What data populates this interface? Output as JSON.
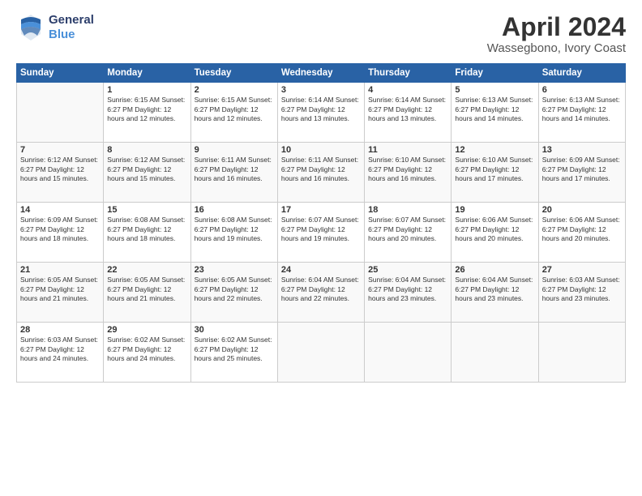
{
  "header": {
    "logo_line1": "General",
    "logo_line2": "Blue",
    "title": "April 2024",
    "subtitle": "Wassegbono, Ivory Coast"
  },
  "weekdays": [
    "Sunday",
    "Monday",
    "Tuesday",
    "Wednesday",
    "Thursday",
    "Friday",
    "Saturday"
  ],
  "weeks": [
    [
      {
        "day": "",
        "info": ""
      },
      {
        "day": "1",
        "info": "Sunrise: 6:15 AM\nSunset: 6:27 PM\nDaylight: 12 hours\nand 12 minutes."
      },
      {
        "day": "2",
        "info": "Sunrise: 6:15 AM\nSunset: 6:27 PM\nDaylight: 12 hours\nand 12 minutes."
      },
      {
        "day": "3",
        "info": "Sunrise: 6:14 AM\nSunset: 6:27 PM\nDaylight: 12 hours\nand 13 minutes."
      },
      {
        "day": "4",
        "info": "Sunrise: 6:14 AM\nSunset: 6:27 PM\nDaylight: 12 hours\nand 13 minutes."
      },
      {
        "day": "5",
        "info": "Sunrise: 6:13 AM\nSunset: 6:27 PM\nDaylight: 12 hours\nand 14 minutes."
      },
      {
        "day": "6",
        "info": "Sunrise: 6:13 AM\nSunset: 6:27 PM\nDaylight: 12 hours\nand 14 minutes."
      }
    ],
    [
      {
        "day": "7",
        "info": "Sunrise: 6:12 AM\nSunset: 6:27 PM\nDaylight: 12 hours\nand 15 minutes."
      },
      {
        "day": "8",
        "info": "Sunrise: 6:12 AM\nSunset: 6:27 PM\nDaylight: 12 hours\nand 15 minutes."
      },
      {
        "day": "9",
        "info": "Sunrise: 6:11 AM\nSunset: 6:27 PM\nDaylight: 12 hours\nand 16 minutes."
      },
      {
        "day": "10",
        "info": "Sunrise: 6:11 AM\nSunset: 6:27 PM\nDaylight: 12 hours\nand 16 minutes."
      },
      {
        "day": "11",
        "info": "Sunrise: 6:10 AM\nSunset: 6:27 PM\nDaylight: 12 hours\nand 16 minutes."
      },
      {
        "day": "12",
        "info": "Sunrise: 6:10 AM\nSunset: 6:27 PM\nDaylight: 12 hours\nand 17 minutes."
      },
      {
        "day": "13",
        "info": "Sunrise: 6:09 AM\nSunset: 6:27 PM\nDaylight: 12 hours\nand 17 minutes."
      }
    ],
    [
      {
        "day": "14",
        "info": "Sunrise: 6:09 AM\nSunset: 6:27 PM\nDaylight: 12 hours\nand 18 minutes."
      },
      {
        "day": "15",
        "info": "Sunrise: 6:08 AM\nSunset: 6:27 PM\nDaylight: 12 hours\nand 18 minutes."
      },
      {
        "day": "16",
        "info": "Sunrise: 6:08 AM\nSunset: 6:27 PM\nDaylight: 12 hours\nand 19 minutes."
      },
      {
        "day": "17",
        "info": "Sunrise: 6:07 AM\nSunset: 6:27 PM\nDaylight: 12 hours\nand 19 minutes."
      },
      {
        "day": "18",
        "info": "Sunrise: 6:07 AM\nSunset: 6:27 PM\nDaylight: 12 hours\nand 20 minutes."
      },
      {
        "day": "19",
        "info": "Sunrise: 6:06 AM\nSunset: 6:27 PM\nDaylight: 12 hours\nand 20 minutes."
      },
      {
        "day": "20",
        "info": "Sunrise: 6:06 AM\nSunset: 6:27 PM\nDaylight: 12 hours\nand 20 minutes."
      }
    ],
    [
      {
        "day": "21",
        "info": "Sunrise: 6:05 AM\nSunset: 6:27 PM\nDaylight: 12 hours\nand 21 minutes."
      },
      {
        "day": "22",
        "info": "Sunrise: 6:05 AM\nSunset: 6:27 PM\nDaylight: 12 hours\nand 21 minutes."
      },
      {
        "day": "23",
        "info": "Sunrise: 6:05 AM\nSunset: 6:27 PM\nDaylight: 12 hours\nand 22 minutes."
      },
      {
        "day": "24",
        "info": "Sunrise: 6:04 AM\nSunset: 6:27 PM\nDaylight: 12 hours\nand 22 minutes."
      },
      {
        "day": "25",
        "info": "Sunrise: 6:04 AM\nSunset: 6:27 PM\nDaylight: 12 hours\nand 23 minutes."
      },
      {
        "day": "26",
        "info": "Sunrise: 6:04 AM\nSunset: 6:27 PM\nDaylight: 12 hours\nand 23 minutes."
      },
      {
        "day": "27",
        "info": "Sunrise: 6:03 AM\nSunset: 6:27 PM\nDaylight: 12 hours\nand 23 minutes."
      }
    ],
    [
      {
        "day": "28",
        "info": "Sunrise: 6:03 AM\nSunset: 6:27 PM\nDaylight: 12 hours\nand 24 minutes."
      },
      {
        "day": "29",
        "info": "Sunrise: 6:02 AM\nSunset: 6:27 PM\nDaylight: 12 hours\nand 24 minutes."
      },
      {
        "day": "30",
        "info": "Sunrise: 6:02 AM\nSunset: 6:27 PM\nDaylight: 12 hours\nand 25 minutes."
      },
      {
        "day": "",
        "info": ""
      },
      {
        "day": "",
        "info": ""
      },
      {
        "day": "",
        "info": ""
      },
      {
        "day": "",
        "info": ""
      }
    ]
  ]
}
